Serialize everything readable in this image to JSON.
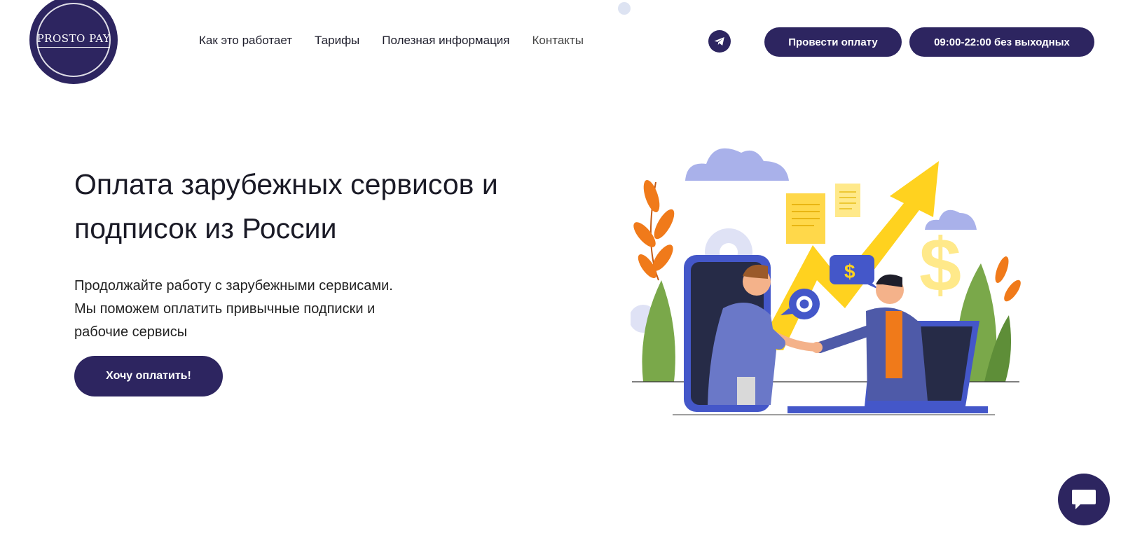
{
  "brand": {
    "logo_text": "PROSTO PAY"
  },
  "nav": [
    {
      "label": "Как это работает"
    },
    {
      "label": "Тарифы"
    },
    {
      "label": "Полезная информация"
    },
    {
      "label": "Контакты"
    }
  ],
  "header": {
    "telegram_icon": "telegram-icon",
    "pay_button": "Провести оплату",
    "hours_button": "09:00-22:00 без выходных"
  },
  "hero": {
    "title_line1": "Оплата зарубежных сервисов и",
    "title_line2": "подписок из России",
    "subtitle_line1": "Продолжайте работу с зарубежными сервисами.",
    "subtitle_line2": "Мы поможем оплатить привычные подписки и",
    "subtitle_line3": "рабочие сервисы",
    "cta_button": "Хочу оплатить!"
  },
  "illustration": {
    "dollar_symbol": "$",
    "description_icon": "handshake-illustration"
  },
  "chat_widget": {
    "icon": "chat-bubble-icon"
  },
  "colors": {
    "primary": "#2d2560",
    "accent_yellow": "#ffd21f",
    "accent_orange": "#f07a1a",
    "accent_blue": "#4457c9",
    "accent_lilac": "#a9b1ea",
    "accent_green": "#7aa84a"
  }
}
